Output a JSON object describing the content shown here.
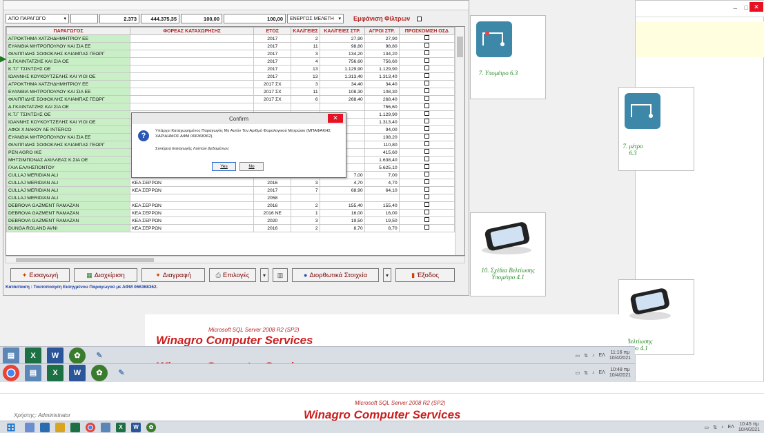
{
  "colors": {
    "accent_red": "#cc1d1d",
    "producer_green": "#c9efc6",
    "status_blue": "#1b3fa8"
  },
  "toolbar": {
    "filter_select": "ΑΠΟ ΠΑΡΑΓΩΓΟ",
    "count": "2.373",
    "total": "444.375,35",
    "percent": "100,00",
    "percent2": "100,00",
    "status_select": "ΕΝΕΡΓΟΣ ΜΕΛΕΤΗ",
    "show_filters_label": "Εμφάνιση Φίλτρων"
  },
  "table": {
    "headers": [
      "ΠΑΡΑΓΩΓΟΣ",
      "ΦΟΡΕΑΣ ΚΑΤΑΧΩΡΗΣΗΣ",
      "ΕΤΟΣ",
      "ΚΑΛ/ΓΕΙΕΣ",
      "ΚΑΛ/ΓΕΙΕΣ ΣΤΡ.",
      "ΑΓΡΟΙ ΣΤΡ.",
      "ΠΡΟΣΚΟΜΙΣΗ ΟΣΔ"
    ],
    "rows": [
      [
        "ΑΓΡΟΚΤΗΜΑ ΧΑΤΖΗΔΗΜΗΤΡΙΟΥ ΕΕ",
        "",
        "2017",
        "2",
        "27,90",
        "27,90"
      ],
      [
        "ΕΥΑΝΘΙΑ ΜΗΤΡΟΠΟΥΛΟΥ ΚΑΙ ΣΙΑ ΕΕ",
        "",
        "2017",
        "11",
        "98,80",
        "98,80"
      ],
      [
        "ΦΙΛΙΠΠΙΔΗΣ ΣΟΦΟΚΛΗΣ ΚΛΙΑΜΠΑΣ ΓΕΩΡΓ",
        "",
        "2017",
        "3",
        "134,20",
        "134,20"
      ],
      [
        "Δ.ΓΚΑΙΝΤΑΤΖΗΣ ΚΑΙ ΣΙΑ ΟΕ",
        "",
        "2017",
        "4",
        "756,60",
        "756,60"
      ],
      [
        "Κ.Τ.Γ ΤΣΙΝΤΣΗΣ ΟΕ",
        "",
        "2017",
        "13",
        "1.129,90",
        "1.129,90"
      ],
      [
        "ΙΩΑΝΝΗΣ ΚΟΥΚΟΥΤΖΕΛΗΣ ΚΑΙ ΥΙΟΙ ΟΕ",
        "",
        "2017",
        "13",
        "1.313,40",
        "1.313,40"
      ],
      [
        "ΑΓΡΟΚΤΗΜΑ ΧΑΤΖΗΔΗΜΗΤΡΙΟΥ ΕΕ",
        "",
        "2017 ΣΧ",
        "3",
        "34,40",
        "34,40"
      ],
      [
        "ΕΥΑΝΘΙΑ ΜΗΤΡΟΠΟΥΛΟΥ ΚΑΙ ΣΙΑ ΕΕ",
        "",
        "2017 ΣΧ",
        "11",
        "108,30",
        "108,30"
      ],
      [
        "ΦΙΛΙΠΠΙΔΗΣ ΣΟΦΟΚΛΗΣ ΚΛΙΑΜΠΑΣ ΓΕΩΡΓ",
        "",
        "2017 ΣΧ",
        "6",
        "268,40",
        "268,40"
      ],
      [
        "Δ.ΓΚΑΙΝΤΑΤΖΗΣ ΚΑΙ ΣΙΑ ΟΕ",
        "",
        "",
        "",
        "",
        "756,60"
      ],
      [
        "Κ.Τ.Γ ΤΣΙΝΤΣΗΣ ΟΕ",
        "",
        "",
        "",
        "",
        "1.129,90"
      ],
      [
        "ΙΩΑΝΝΗΣ ΚΟΥΚΟΥΤΖΕΛΗΣ ΚΑΙ ΥΙΟΙ ΟΕ",
        "",
        "",
        "",
        "",
        "1.313,40"
      ],
      [
        "ΑΦΟΙ Χ.ΝΑΚΟΥ ΑΕ INTERCO",
        "",
        "",
        "",
        "",
        "94,00"
      ],
      [
        "ΕΥΑΝΘΙΑ ΜΗΤΡΟΠΟΥΛΟΥ ΚΑΙ ΣΙΑ ΕΕ",
        "",
        "",
        "",
        "",
        "108,20"
      ],
      [
        "ΦΙΛΙΠΠΙΔΗΣ ΣΟΦΟΚΛΗΣ ΚΛΙΑΜΠΑΣ ΓΕΩΡΓ",
        "",
        "",
        "",
        "",
        "110,80"
      ],
      [
        "PEN AGRO IKE",
        "",
        "",
        "",
        "",
        "415,60"
      ],
      [
        "ΜΗΤΣΙΜΠΟΝΑΣ ΑΧΙΛΛΕΑΣ Κ.ΣΙΑ ΟΕ",
        "",
        "",
        "",
        "",
        "1.638,40"
      ],
      [
        "ΓΑΙΑ ΕΛΛΗΣΠΟΝΤΟΥ",
        "",
        "",
        "",
        "",
        "5.625,10"
      ],
      [
        "CULLAJ MERIDIAN ALI",
        "",
        "2014",
        "3",
        "7,00",
        "7,00"
      ],
      [
        "CULLAJ MERIDIAN ALI",
        "ΚΕΑ ΣΕΡΡΩΝ",
        "2016",
        "3",
        "4,70",
        "4,70"
      ],
      [
        "CULLAJ MERIDIAN ALI",
        "ΚΕΑ ΣΕΡΡΩΝ",
        "2017",
        "7",
        "68,90",
        "64,10"
      ],
      [
        "CULLAJ MERIDIAN ALI",
        "",
        "2058",
        "",
        "",
        ""
      ],
      [
        "DEBROVA GAZMENT RAMAZAN",
        "ΚΕΑ ΣΕΡΡΩΝ",
        "2016",
        "2",
        "155,40",
        "155,40"
      ],
      [
        "DEBROVA GAZMENT RAMAZAN",
        "ΚΕΑ ΣΕΡΡΩΝ",
        "2016 ΝΕ",
        "1",
        "16,00",
        "16,00"
      ],
      [
        "DEBROVA GAZMENT RAMAZAN",
        "ΚΕΑ ΣΕΡΡΩΝ",
        "2020",
        "3",
        "19,50",
        "19,50"
      ],
      [
        "DUNGA ROLAND AVNI",
        "ΚΕΑ ΣΕΡΡΩΝ",
        "2016",
        "2",
        "8,70",
        "8,70"
      ]
    ]
  },
  "buttons": {
    "insert": "Εισαγωγή",
    "manage": "Διαχείριση",
    "delete": "Διαγραφή",
    "options": "Επιλογές",
    "corrective": "Διορθωτικά Στοιχεία",
    "exit": "Έξοδος"
  },
  "status_text": "Κατάσταση : Ταυτοποίηση Εισηγμένου Παραγωγού με ΑΦΜ 066368362.",
  "dialog": {
    "title": "Confirm",
    "message": "Υπάρχει Καταχωρημένος Παραγωγός Με Αυτόν Τον Αριθμό Φορολογικού Μητρώου (ΜΠΑΦΑΚΗΣ ΧΑΡΙΔΗΜΟΣ ΑΦΜ 066368362).",
    "question": "Συνέχεια Εισαγωγής Λοιπών Δεδομένων;",
    "yes": "Yes",
    "no": "No"
  },
  "cards": {
    "c1": "7. Υπομέτρο 6.3",
    "c2": "7. μέτρο 6.3",
    "c3": "10. Σχέδια Βελτίωσης Υπομέτρο 4.1",
    "c4": "ια Βελτίωσης μέτρο 4.1"
  },
  "footer": {
    "sql": "Microsoft SQL Server 2008 R2 (SP2)",
    "brand": "Winagro Computer Services",
    "user": "Χρήστης: Administrator"
  },
  "clocks": {
    "c1_time": "11:16 πμ",
    "c1_date": "10/4/2021",
    "c2_time": "10:48 πμ",
    "c2_date": "10/4/2021",
    "c3_time": "10:45 πμ",
    "c3_date": "10/4/2021",
    "lang": "ΕΛ"
  }
}
